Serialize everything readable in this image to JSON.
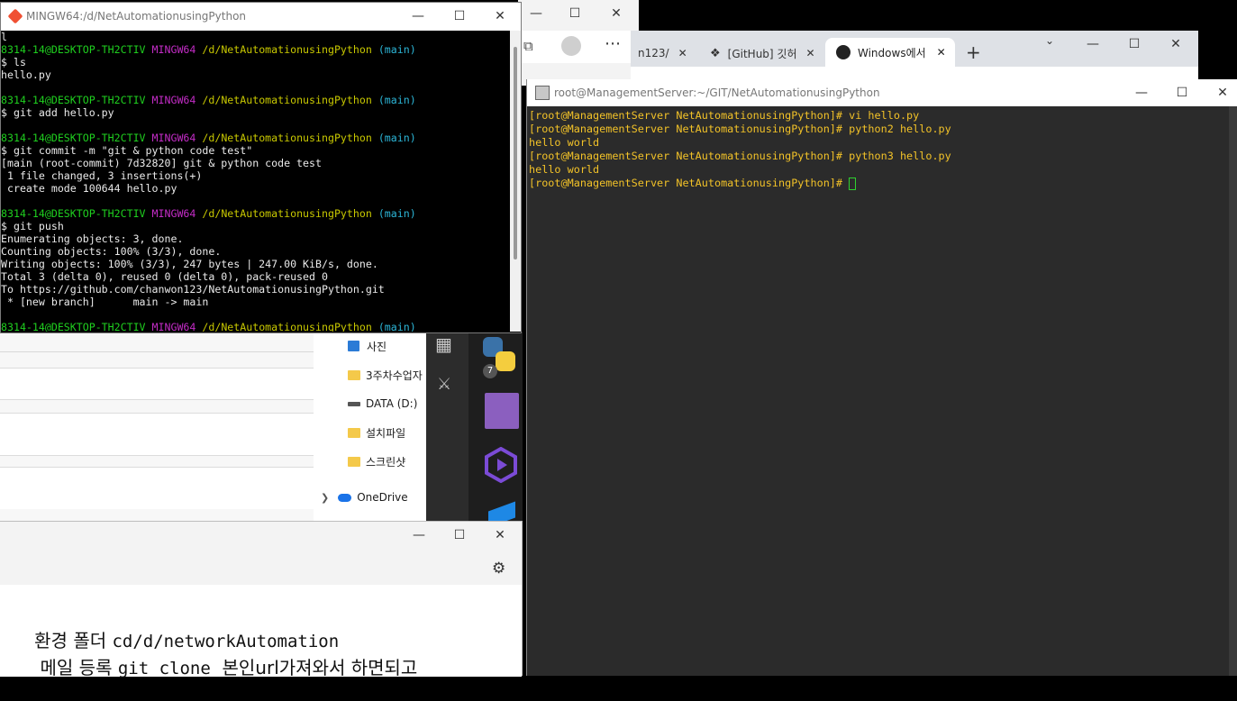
{
  "git_bash": {
    "title": "MINGW64:/d/NetAutomationusingPython",
    "lines": [
      [
        {
          "t": "l",
          "c": "white"
        }
      ],
      [
        {
          "t": "8314-14@DESKTOP-TH2CTIV ",
          "c": "green"
        },
        {
          "t": "MINGW64 ",
          "c": "magenta"
        },
        {
          "t": "/d/NetAutomationusingPython ",
          "c": "yellow"
        },
        {
          "t": "(main)",
          "c": "cyan"
        }
      ],
      [
        {
          "t": "$ ls",
          "c": "white"
        }
      ],
      [
        {
          "t": "hello.py",
          "c": "white"
        }
      ],
      [
        {
          "t": "",
          "c": "white"
        }
      ],
      [
        {
          "t": "8314-14@DESKTOP-TH2CTIV ",
          "c": "green"
        },
        {
          "t": "MINGW64 ",
          "c": "magenta"
        },
        {
          "t": "/d/NetAutomationusingPython ",
          "c": "yellow"
        },
        {
          "t": "(main)",
          "c": "cyan"
        }
      ],
      [
        {
          "t": "$ git add hello.py",
          "c": "white"
        }
      ],
      [
        {
          "t": "",
          "c": "white"
        }
      ],
      [
        {
          "t": "8314-14@DESKTOP-TH2CTIV ",
          "c": "green"
        },
        {
          "t": "MINGW64 ",
          "c": "magenta"
        },
        {
          "t": "/d/NetAutomationusingPython ",
          "c": "yellow"
        },
        {
          "t": "(main)",
          "c": "cyan"
        }
      ],
      [
        {
          "t": "$ git commit -m \"git & python code test\"",
          "c": "white"
        }
      ],
      [
        {
          "t": "[main (root-commit) 7d32820] git & python code test",
          "c": "white"
        }
      ],
      [
        {
          "t": " 1 file changed, 3 insertions(+)",
          "c": "white"
        }
      ],
      [
        {
          "t": " create mode 100644 hello.py",
          "c": "white"
        }
      ],
      [
        {
          "t": "",
          "c": "white"
        }
      ],
      [
        {
          "t": "8314-14@DESKTOP-TH2CTIV ",
          "c": "green"
        },
        {
          "t": "MINGW64 ",
          "c": "magenta"
        },
        {
          "t": "/d/NetAutomationusingPython ",
          "c": "yellow"
        },
        {
          "t": "(main)",
          "c": "cyan"
        }
      ],
      [
        {
          "t": "$ git push",
          "c": "white"
        }
      ],
      [
        {
          "t": "Enumerating objects: 3, done.",
          "c": "white"
        }
      ],
      [
        {
          "t": "Counting objects: 100% (3/3), done.",
          "c": "white"
        }
      ],
      [
        {
          "t": "Writing objects: 100% (3/3), 247 bytes | 247.00 KiB/s, done.",
          "c": "white"
        }
      ],
      [
        {
          "t": "Total 3 (delta 0), reused 0 (delta 0), pack-reused 0",
          "c": "white"
        }
      ],
      [
        {
          "t": "To https://github.com/chanwon123/NetAutomationusingPython.git",
          "c": "white"
        }
      ],
      [
        {
          "t": " * [new branch]      main -> main",
          "c": "white"
        }
      ],
      [
        {
          "t": "",
          "c": "white"
        }
      ],
      [
        {
          "t": "8314-14@DESKTOP-TH2CTIV ",
          "c": "green"
        },
        {
          "t": "MINGW64 ",
          "c": "magenta"
        },
        {
          "t": "/d/NetAutomationusingPython ",
          "c": "yellow"
        },
        {
          "t": "(main)",
          "c": "cyan"
        }
      ]
    ]
  },
  "putty": {
    "title": "root@ManagementServer:~/GIT/NetAutomationusingPython",
    "lines": [
      [
        {
          "t": "[root@ManagementServer NetAutomationusingPython]# ",
          "c": "p"
        },
        {
          "t": "vi hello.py",
          "c": "p"
        }
      ],
      [
        {
          "t": "[root@ManagementServer NetAutomationusingPython]# ",
          "c": "p"
        },
        {
          "t": "python2 hello.py",
          "c": "p"
        }
      ],
      [
        {
          "t": "hello world",
          "c": "p"
        }
      ],
      [
        {
          "t": "[root@ManagementServer NetAutomationusingPython]# ",
          "c": "p"
        },
        {
          "t": "python3 hello.py",
          "c": "p"
        }
      ],
      [
        {
          "t": "hello world",
          "c": "p"
        }
      ],
      [
        {
          "t": "[root@ManagementServer NetAutomationusingPython]# ",
          "c": "p"
        }
      ]
    ]
  },
  "chrome": {
    "tabs": [
      {
        "label": "n123/"
      },
      {
        "label": "[GitHub] 깃허"
      },
      {
        "label": "Windows에서"
      }
    ],
    "new_tab": "+"
  },
  "explorer": {
    "items": [
      {
        "label": "사진",
        "icon": "photos-icon"
      },
      {
        "label": "3주차수업자",
        "icon": "folder-icon"
      },
      {
        "label": "DATA (D:)",
        "icon": "drive-icon"
      },
      {
        "label": "설치파일",
        "icon": "folder-icon"
      },
      {
        "label": "스크린샷",
        "icon": "folder-icon"
      },
      {
        "label": "OneDrive",
        "icon": "onedrive-icon"
      }
    ]
  },
  "vscode": {
    "badge": "7"
  },
  "notes": {
    "line1_prefix": "환경 폴더 ",
    "line1_code": "cd/d/networkAutomation",
    "line2_prefix": " 메일 등록 ",
    "line2_code": "git clone",
    "line2_suffix": "  본인url가져와서 하면되고"
  }
}
